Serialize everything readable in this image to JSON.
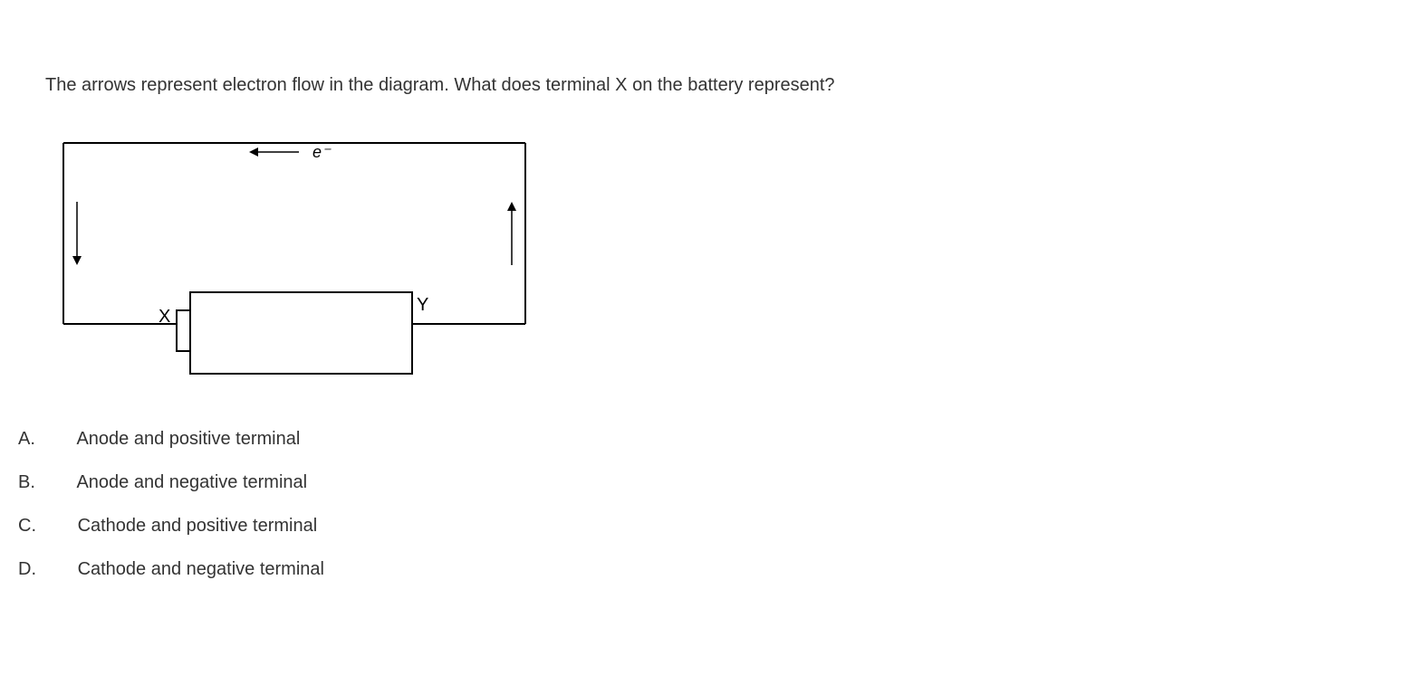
{
  "question": "The arrows represent electron flow in the diagram. What does terminal X on the battery represent?",
  "diagram": {
    "electron_label": "e⁻",
    "terminal_x": "X",
    "terminal_y": "Y"
  },
  "options": [
    {
      "letter": "A.",
      "text": "Anode and positive terminal"
    },
    {
      "letter": "B.",
      "text": "Anode and negative terminal"
    },
    {
      "letter": "C.",
      "text": "Cathode and positive terminal"
    },
    {
      "letter": "D.",
      "text": "Cathode and negative terminal"
    }
  ]
}
